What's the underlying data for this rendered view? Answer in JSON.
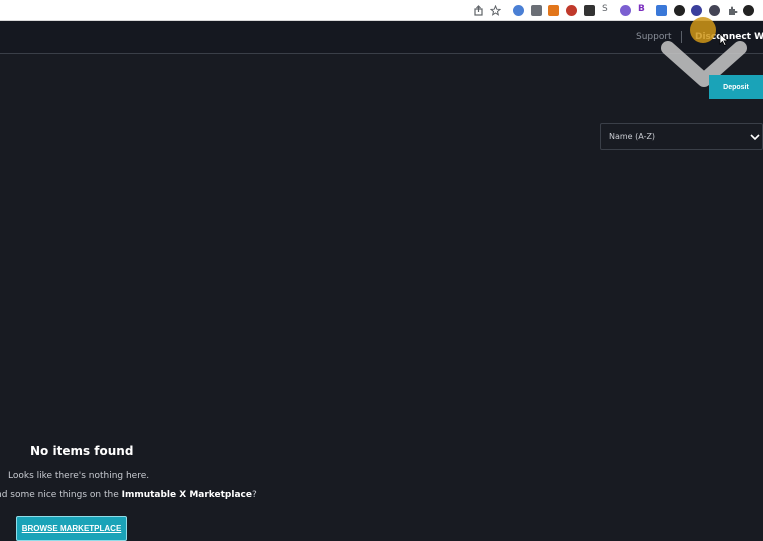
{
  "header": {
    "support_label": "Support",
    "disconnect_label": "Disconnect Wallet"
  },
  "actions": {
    "deposit_label": "Deposit"
  },
  "sort": {
    "selected": "Name (A-Z)"
  },
  "empty_state": {
    "title": "No items found",
    "subtitle": "Looks like there's nothing here.",
    "prompt_prefix": "nd some nice things on the ",
    "prompt_brand": "Immutable X Marketplace",
    "prompt_suffix": "?",
    "browse_label": "BROWSE MARKETPLACE"
  },
  "colors": {
    "background": "#181b22",
    "accent": "#1aa3b8",
    "cursor_highlight": "#cf9617"
  },
  "browser_icons": [
    "share-icon",
    "bookmark-star-icon",
    "extension-icon",
    "extension-icon",
    "metamask-icon",
    "extension-icon",
    "extension-icon",
    "extension-icon",
    "extension-icon",
    "extension-icon",
    "extension-icon",
    "extension-icon",
    "extension-icon",
    "extension-icon",
    "puzzle-icon",
    "profile-icon"
  ]
}
